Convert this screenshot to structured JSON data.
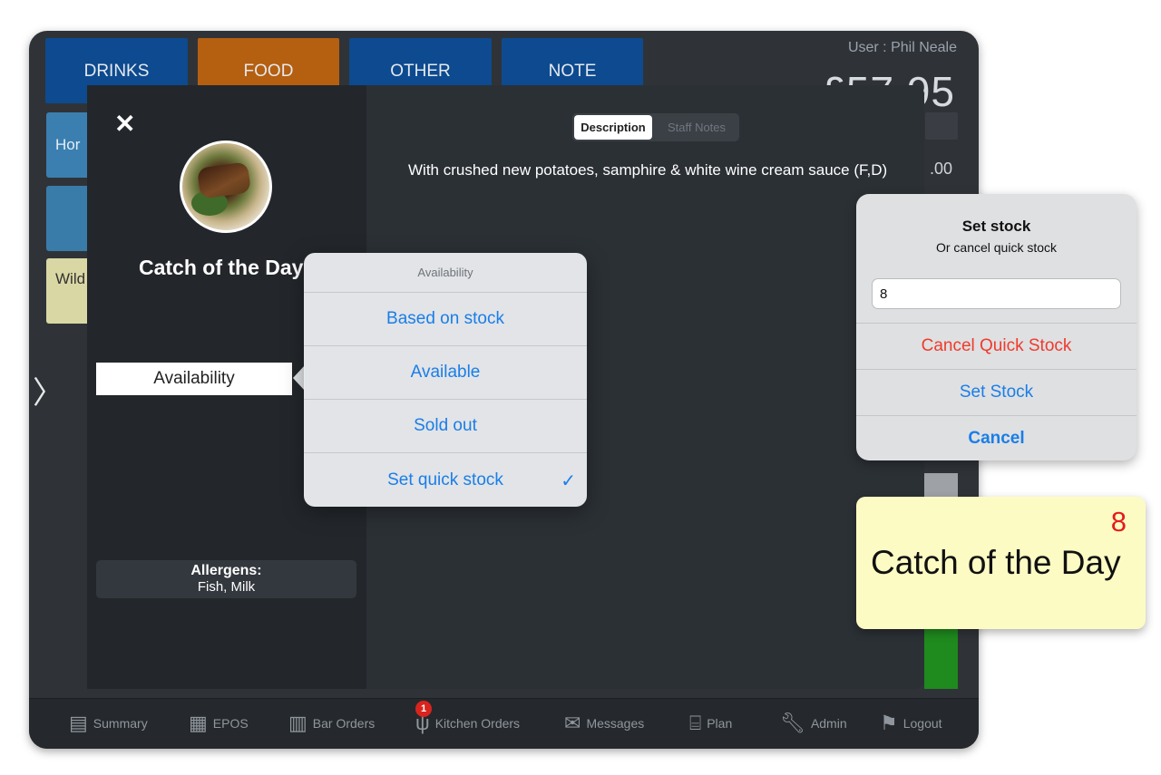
{
  "header": {
    "tabs": [
      {
        "label": "DRINKS",
        "color": "#0d4a8f"
      },
      {
        "label": "FOOD",
        "color": "#b55f10"
      },
      {
        "label": "OTHER",
        "color": "#0d4a8f"
      },
      {
        "label": "NOTE",
        "color": "#0d4a8f"
      }
    ],
    "user": "User : Phil Neale",
    "total": "£57.95"
  },
  "side_items": {
    "hor": "Hor",
    "wild": "Wild"
  },
  "right_panel": {
    "amount": ".00"
  },
  "modal": {
    "close_icon": "close-icon",
    "dish_name": "Catch of the Day",
    "availability_button": "Availability",
    "allergens_heading": "Allergens:",
    "allergens_value": "Fish, Milk",
    "segments": {
      "description": "Description",
      "staff_notes": "Staff Notes"
    },
    "description": "With crushed new potatoes, samphire & white wine cream sauce (F,D)"
  },
  "popover": {
    "title": "Availability",
    "options": [
      {
        "label": "Based on stock",
        "checked": false
      },
      {
        "label": "Available",
        "checked": false
      },
      {
        "label": "Sold out",
        "checked": false
      },
      {
        "label": "Set quick stock",
        "checked": true
      }
    ],
    "check_mark": "✓"
  },
  "dialog": {
    "title": "Set stock",
    "subtitle": "Or cancel quick stock",
    "input_value": "8",
    "cancel_quick_stock": "Cancel Quick Stock",
    "set_stock": "Set Stock",
    "cancel": "Cancel"
  },
  "tile": {
    "count": "8",
    "name": "Catch of the Day"
  },
  "toolbar": {
    "items": [
      {
        "label": "Summary",
        "icon": "notepad-icon"
      },
      {
        "label": "EPOS",
        "icon": "calculator-icon"
      },
      {
        "label": "Bar Orders",
        "icon": "pint-glass-icon"
      },
      {
        "label": "Kitchen Orders",
        "icon": "cutlery-icon",
        "badge": "1"
      },
      {
        "label": "Messages",
        "icon": "envelope-icon"
      },
      {
        "label": "Plan",
        "icon": "floor-plan-icon"
      },
      {
        "label": "Admin",
        "icon": "wrench-icon"
      },
      {
        "label": "Logout",
        "icon": "running-person-icon"
      }
    ]
  },
  "colors": {
    "accent_blue": "#1a7ee8",
    "destructive_red": "#ef3b2c",
    "tile_yellow": "#fdfbc4"
  }
}
